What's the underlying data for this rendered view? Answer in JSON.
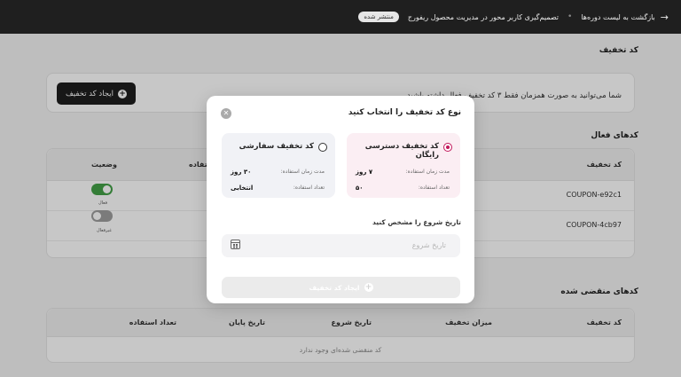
{
  "topbar": {
    "back_label": "بازگشت به لیست دوره‌ها",
    "separator": "•",
    "course_name": "تصمیم‌گیری کاربر محور در مدیریت محصول ریفورج",
    "status_badge": "منتشر شده"
  },
  "discount_section": {
    "title": "کد تخفیف",
    "info_text": "شما می‌توانید به صورت همزمان فقط ۳ کد تخفیف فعال داشته باشید.",
    "create_button": "ایجاد کد تخفیف"
  },
  "active_codes": {
    "title": "کدهای فعال",
    "columns": {
      "code": "کد تخفیف",
      "usage": "ستفاده",
      "status": "وضعیت"
    },
    "rows": [
      {
        "code": "COUPON-e92c1",
        "status_label": "فعال",
        "active": true
      },
      {
        "code": "COUPON-4cb97",
        "status_label": "غیرفعال",
        "active": false
      }
    ]
  },
  "expired_codes": {
    "title": "کدهای منقضی شده",
    "columns": [
      "کد تخفیف",
      "میزان تخفیف",
      "تاریخ شروع",
      "تاریخ پایان",
      "تعداد استفاده"
    ],
    "empty_text": "کد منقضی شده‌ای وجود ندارد"
  },
  "modal": {
    "title": "نوع کد تخفیف را انتخاب کنید",
    "options": [
      {
        "title": "کد تخفیف دسترسی رایگان",
        "duration_label": "مدت زمان استفاده:",
        "duration_value": "۷ روز",
        "count_label": "تعداد استفاده:",
        "count_value": "۵۰",
        "selected": true
      },
      {
        "title": "کد تخفیف سفارشی",
        "duration_label": "مدت زمان استفاده:",
        "duration_value": "۳۰ روز",
        "count_label": "تعداد استفاده:",
        "count_value": "انتخابی",
        "selected": false
      }
    ],
    "date_label": "تاریخ شروع را مشخص کنید",
    "date_placeholder": "تاریخ شروع",
    "submit_button": "ایجاد کد تخفیف",
    "close_icon": "close-icon",
    "calendar_icon": "calendar-icon"
  },
  "colors": {
    "accent": "#c2185b",
    "toggle_on": "#43a047",
    "toggle_off": "#9e9e9e",
    "topbar": "#1f1f1f"
  }
}
